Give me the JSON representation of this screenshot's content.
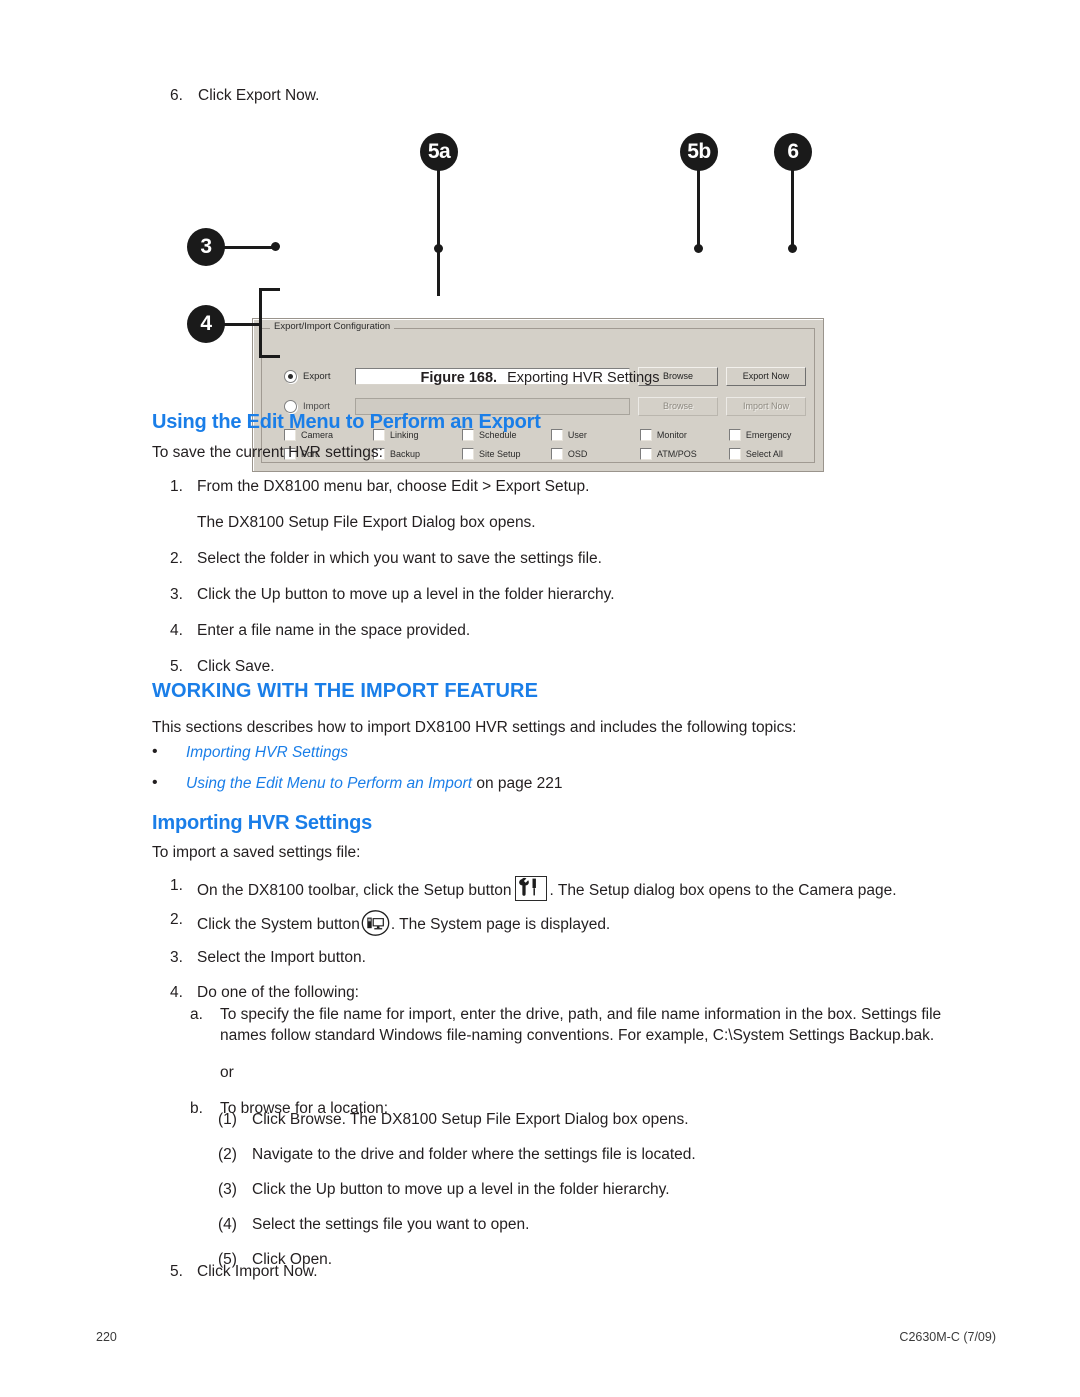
{
  "page": {
    "number": "220",
    "doc_code": "C2630M-C (7/09)"
  },
  "top_step": {
    "marker": "6.",
    "text": "Click Export Now."
  },
  "figure": {
    "caption_label": "Figure 168.",
    "caption_text": "Exporting HVR Settings",
    "callouts": [
      {
        "id": "callout-5a",
        "label": "5a"
      },
      {
        "id": "callout-5b",
        "label": "5b"
      },
      {
        "id": "callout-6",
        "label": "6"
      },
      {
        "id": "callout-3",
        "label": "3"
      },
      {
        "id": "callout-4",
        "label": "4"
      }
    ],
    "dialog": {
      "groupbox_title": "Export/Import Configuration",
      "export": {
        "radio_label": "Export",
        "field_value": "",
        "browse_label": "Browse",
        "action_label": "Export Now"
      },
      "import": {
        "radio_label": "Import",
        "field_value": "",
        "browse_label": "Browse",
        "action_label": "Import Now"
      },
      "checkbox_rows": [
        [
          "Camera",
          "Linking",
          "Schedule",
          "User",
          "Monitor",
          "Emergency"
        ],
        [
          "Port",
          "Backup",
          "Site Setup",
          "OSD",
          "ATM/POS",
          "Select All"
        ]
      ]
    }
  },
  "section_export": {
    "heading": "Using the Edit Menu to Perform an Export",
    "lead": "To save the current HVR settings:",
    "steps": [
      {
        "marker": "1.",
        "text": "From the DX8100 menu bar, choose Edit > Export Setup."
      },
      {
        "marker": "",
        "text": "The DX8100 Setup File Export Dialog box opens."
      },
      {
        "marker": "2.",
        "text": "Select the folder in which you want to save the settings file."
      },
      {
        "marker": "3.",
        "text": "Click the Up button to move up a level in the folder hierarchy."
      },
      {
        "marker": "4.",
        "text": "Enter a file name in the space provided."
      },
      {
        "marker": "5.",
        "text": "Click Save."
      }
    ]
  },
  "section_import": {
    "heading": "WORKING WITH THE IMPORT FEATURE",
    "lead": "This sections describes how to import DX8100 HVR settings and includes the following topics:",
    "bullets": [
      {
        "link": "Importing HVR Settings",
        "suffix": ""
      },
      {
        "link": "Using the Edit Menu to Perform an Import",
        "suffix": " on page 221"
      }
    ],
    "sub_heading": "Importing HVR Settings",
    "sub_lead": "To import a saved settings file:",
    "steps": [
      {
        "marker": "1.",
        "before": "On the DX8100 toolbar, click the Setup button",
        "icon": "setup-tools-icon",
        "after": ". The Setup dialog box opens to the Camera page."
      },
      {
        "marker": "2.",
        "before": "Click the System button",
        "icon": "system-computer-icon",
        "after": ". The System page is displayed."
      },
      {
        "marker": "3.",
        "text": "Select the Import button."
      },
      {
        "marker": "4.",
        "text": "Do one of the following:"
      }
    ],
    "letter_steps": [
      {
        "marker": "a.",
        "text": "To specify the file name for import, enter the drive, path, and file name information in the box. Settings file names follow standard Windows file-naming conventions. For example, C:\\System Settings Backup.bak."
      },
      {
        "marker": "",
        "text": "or"
      },
      {
        "marker": "b.",
        "text": "To browse for a location:"
      }
    ],
    "paren_steps": [
      {
        "marker": "(1)",
        "text": "Click Browse. The DX8100 Setup File Export Dialog box opens."
      },
      {
        "marker": "(2)",
        "text": "Navigate to the drive and folder where the settings file is located."
      },
      {
        "marker": "(3)",
        "text": "Click the Up button to move up a level in the folder hierarchy."
      },
      {
        "marker": "(4)",
        "text": "Select the settings file you want to open."
      },
      {
        "marker": "(5)",
        "text": "Click Open."
      }
    ],
    "final_step": {
      "marker": "5.",
      "text": "Click Import Now."
    }
  },
  "colors": {
    "heading_blue": "#1a7ee8",
    "body_black": "#231f20",
    "dialog_face": "#d4d0c8"
  }
}
